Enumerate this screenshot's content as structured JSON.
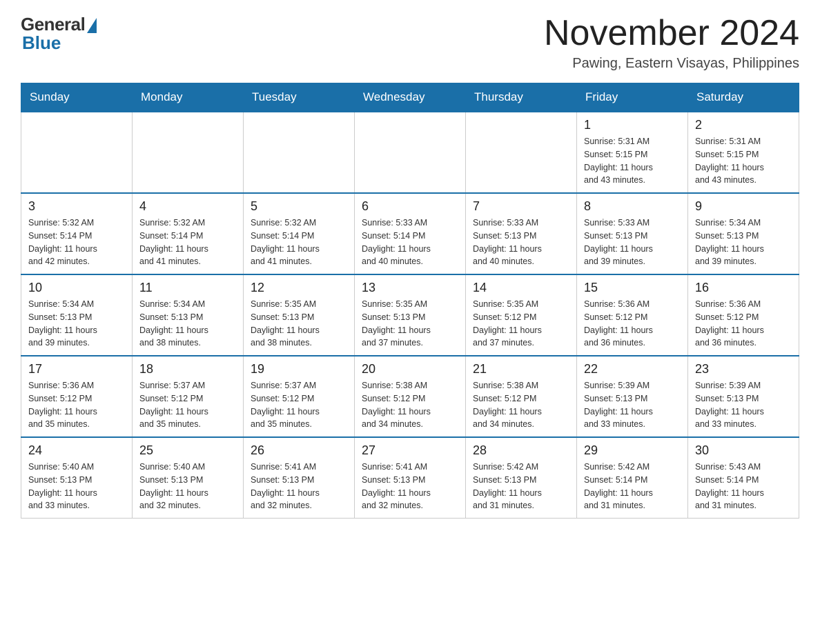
{
  "logo": {
    "general": "General",
    "blue": "Blue"
  },
  "header": {
    "month_title": "November 2024",
    "location": "Pawing, Eastern Visayas, Philippines"
  },
  "days_of_week": [
    "Sunday",
    "Monday",
    "Tuesday",
    "Wednesday",
    "Thursday",
    "Friday",
    "Saturday"
  ],
  "weeks": [
    [
      {
        "day": "",
        "info": ""
      },
      {
        "day": "",
        "info": ""
      },
      {
        "day": "",
        "info": ""
      },
      {
        "day": "",
        "info": ""
      },
      {
        "day": "",
        "info": ""
      },
      {
        "day": "1",
        "info": "Sunrise: 5:31 AM\nSunset: 5:15 PM\nDaylight: 11 hours\nand 43 minutes."
      },
      {
        "day": "2",
        "info": "Sunrise: 5:31 AM\nSunset: 5:15 PM\nDaylight: 11 hours\nand 43 minutes."
      }
    ],
    [
      {
        "day": "3",
        "info": "Sunrise: 5:32 AM\nSunset: 5:14 PM\nDaylight: 11 hours\nand 42 minutes."
      },
      {
        "day": "4",
        "info": "Sunrise: 5:32 AM\nSunset: 5:14 PM\nDaylight: 11 hours\nand 41 minutes."
      },
      {
        "day": "5",
        "info": "Sunrise: 5:32 AM\nSunset: 5:14 PM\nDaylight: 11 hours\nand 41 minutes."
      },
      {
        "day": "6",
        "info": "Sunrise: 5:33 AM\nSunset: 5:14 PM\nDaylight: 11 hours\nand 40 minutes."
      },
      {
        "day": "7",
        "info": "Sunrise: 5:33 AM\nSunset: 5:13 PM\nDaylight: 11 hours\nand 40 minutes."
      },
      {
        "day": "8",
        "info": "Sunrise: 5:33 AM\nSunset: 5:13 PM\nDaylight: 11 hours\nand 39 minutes."
      },
      {
        "day": "9",
        "info": "Sunrise: 5:34 AM\nSunset: 5:13 PM\nDaylight: 11 hours\nand 39 minutes."
      }
    ],
    [
      {
        "day": "10",
        "info": "Sunrise: 5:34 AM\nSunset: 5:13 PM\nDaylight: 11 hours\nand 39 minutes."
      },
      {
        "day": "11",
        "info": "Sunrise: 5:34 AM\nSunset: 5:13 PM\nDaylight: 11 hours\nand 38 minutes."
      },
      {
        "day": "12",
        "info": "Sunrise: 5:35 AM\nSunset: 5:13 PM\nDaylight: 11 hours\nand 38 minutes."
      },
      {
        "day": "13",
        "info": "Sunrise: 5:35 AM\nSunset: 5:13 PM\nDaylight: 11 hours\nand 37 minutes."
      },
      {
        "day": "14",
        "info": "Sunrise: 5:35 AM\nSunset: 5:12 PM\nDaylight: 11 hours\nand 37 minutes."
      },
      {
        "day": "15",
        "info": "Sunrise: 5:36 AM\nSunset: 5:12 PM\nDaylight: 11 hours\nand 36 minutes."
      },
      {
        "day": "16",
        "info": "Sunrise: 5:36 AM\nSunset: 5:12 PM\nDaylight: 11 hours\nand 36 minutes."
      }
    ],
    [
      {
        "day": "17",
        "info": "Sunrise: 5:36 AM\nSunset: 5:12 PM\nDaylight: 11 hours\nand 35 minutes."
      },
      {
        "day": "18",
        "info": "Sunrise: 5:37 AM\nSunset: 5:12 PM\nDaylight: 11 hours\nand 35 minutes."
      },
      {
        "day": "19",
        "info": "Sunrise: 5:37 AM\nSunset: 5:12 PM\nDaylight: 11 hours\nand 35 minutes."
      },
      {
        "day": "20",
        "info": "Sunrise: 5:38 AM\nSunset: 5:12 PM\nDaylight: 11 hours\nand 34 minutes."
      },
      {
        "day": "21",
        "info": "Sunrise: 5:38 AM\nSunset: 5:12 PM\nDaylight: 11 hours\nand 34 minutes."
      },
      {
        "day": "22",
        "info": "Sunrise: 5:39 AM\nSunset: 5:13 PM\nDaylight: 11 hours\nand 33 minutes."
      },
      {
        "day": "23",
        "info": "Sunrise: 5:39 AM\nSunset: 5:13 PM\nDaylight: 11 hours\nand 33 minutes."
      }
    ],
    [
      {
        "day": "24",
        "info": "Sunrise: 5:40 AM\nSunset: 5:13 PM\nDaylight: 11 hours\nand 33 minutes."
      },
      {
        "day": "25",
        "info": "Sunrise: 5:40 AM\nSunset: 5:13 PM\nDaylight: 11 hours\nand 32 minutes."
      },
      {
        "day": "26",
        "info": "Sunrise: 5:41 AM\nSunset: 5:13 PM\nDaylight: 11 hours\nand 32 minutes."
      },
      {
        "day": "27",
        "info": "Sunrise: 5:41 AM\nSunset: 5:13 PM\nDaylight: 11 hours\nand 32 minutes."
      },
      {
        "day": "28",
        "info": "Sunrise: 5:42 AM\nSunset: 5:13 PM\nDaylight: 11 hours\nand 31 minutes."
      },
      {
        "day": "29",
        "info": "Sunrise: 5:42 AM\nSunset: 5:14 PM\nDaylight: 11 hours\nand 31 minutes."
      },
      {
        "day": "30",
        "info": "Sunrise: 5:43 AM\nSunset: 5:14 PM\nDaylight: 11 hours\nand 31 minutes."
      }
    ]
  ]
}
